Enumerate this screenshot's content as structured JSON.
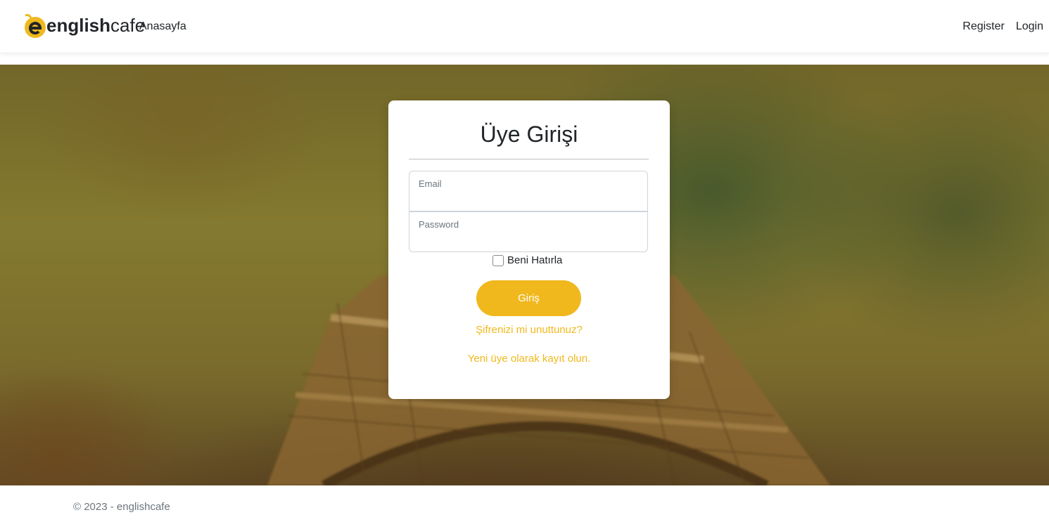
{
  "navbar": {
    "brand_bold": "english",
    "brand_light": "cafe",
    "home_label": "Anasayfa",
    "register_label": "Register",
    "login_label": "Login"
  },
  "login_card": {
    "title": "Üye Girişi",
    "email_label": "Email",
    "email_value": "",
    "password_label": "Password",
    "password_value": "",
    "remember_label": "Beni Hatırla",
    "remember_checked": false,
    "submit_label": "Giriş",
    "forgot_link": "Şifrenizi mi unuttunuz?",
    "register_link": "Yeni üye olarak kayıt olun."
  },
  "footer": {
    "copyright": "© 2023 - englishcafe"
  },
  "colors": {
    "accent": "#f0b81d",
    "text": "#212529",
    "muted": "#6c757d"
  },
  "icons": {
    "logo": "englishcafe-logo-icon",
    "checkbox": "checkbox-unchecked"
  }
}
